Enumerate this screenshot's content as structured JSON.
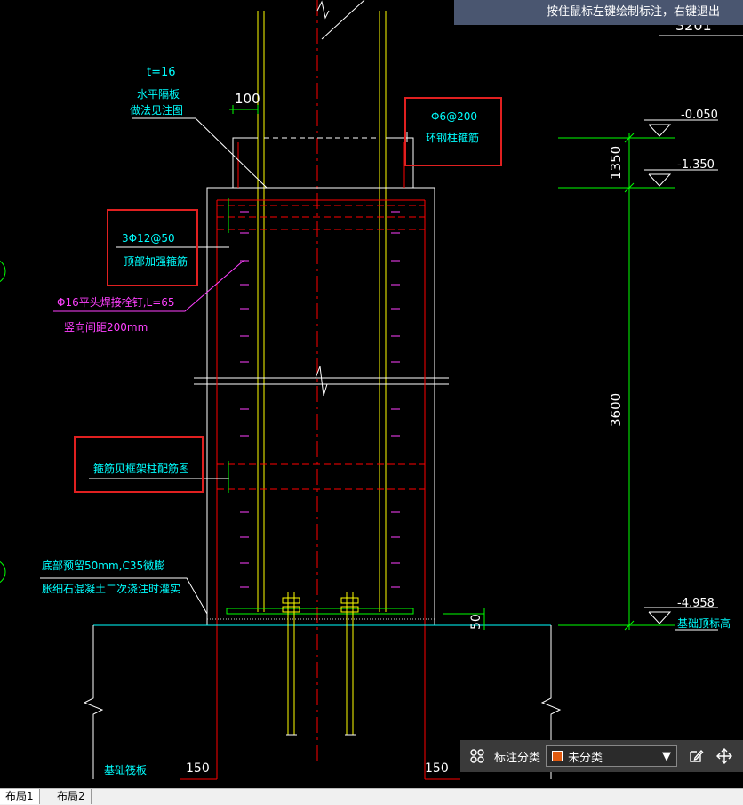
{
  "tooltip": "按住鼠标左键绘制标注，右键退出",
  "drawing": {
    "t_label": "t=16",
    "plate_note_1": "水平隔板",
    "plate_note_2": "做法见注图",
    "dim_100": "100",
    "stirrup_ring_1": "Φ6@200",
    "stirrup_ring_2": "环钢柱箍筋",
    "top_rebar_1": "3Φ12@50",
    "top_rebar_2": "顶部加强箍筋",
    "stud_1": "Φ16平头焊接栓钉,L=65",
    "stud_2": "竖向间距200mm",
    "hoop_note": "箍筋见框架柱配筋图",
    "grout_1": "底部预留50mm,C35微膨",
    "grout_2": "胀细石混凝土二次浇注时灌实",
    "elev_1": "-0.050",
    "elev_2": "-1.350",
    "elev_3": "-4.958",
    "elev_3_note": "基础顶标高",
    "dim_1350": "1350",
    "dim_3600": "3600",
    "dim_50": "50",
    "dim_150_left": "150",
    "dim_150_right": "150",
    "foundation_label": "基础筏板",
    "corner_text": "3201"
  },
  "annotation_bar": {
    "label": "标注分类",
    "selected": "未分类",
    "swatch_color": "#e05a10"
  },
  "tabs": [
    "布局1",
    "布局2"
  ]
}
